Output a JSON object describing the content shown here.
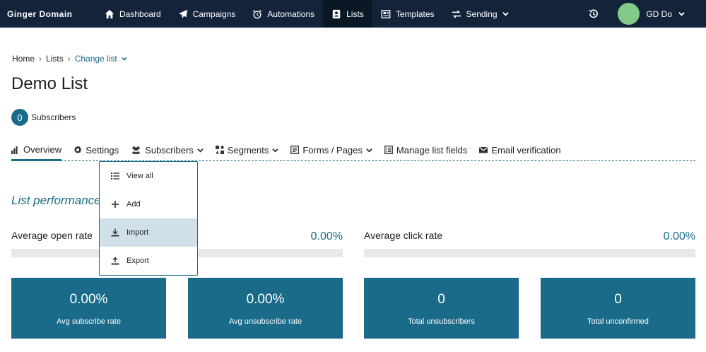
{
  "nav": {
    "brand": "Ginger Domain",
    "items": [
      {
        "label": "Dashboard",
        "icon": "home-icon"
      },
      {
        "label": "Campaigns",
        "icon": "paper-plane-icon"
      },
      {
        "label": "Automations",
        "icon": "alarm-clock-icon"
      },
      {
        "label": "Lists",
        "icon": "address-book-icon"
      },
      {
        "label": "Templates",
        "icon": "newspaper-icon"
      },
      {
        "label": "Sending",
        "icon": "exchange-arrows-icon"
      }
    ],
    "active": "Lists",
    "user": {
      "name": "GD Do",
      "avatar_color": "#82c98a"
    }
  },
  "breadcrumb": {
    "home": "Home",
    "lists": "Lists",
    "change": "Change list"
  },
  "page": {
    "title": "Demo List",
    "subscribers_count": "0",
    "subscribers_label": "Subscribers"
  },
  "tabs": [
    {
      "label": "Overview",
      "icon": "bar-chart-icon"
    },
    {
      "label": "Settings",
      "icon": "gear-icon"
    },
    {
      "label": "Subscribers",
      "icon": "users-icon"
    },
    {
      "label": "Segments",
      "icon": "segments-icon"
    },
    {
      "label": "Forms / Pages",
      "icon": "form-icon"
    },
    {
      "label": "Manage list fields",
      "icon": "list-fields-icon"
    },
    {
      "label": "Email verification",
      "icon": "envelope-icon"
    }
  ],
  "dropdown": {
    "items": [
      {
        "label": "View all",
        "icon": "list-icon"
      },
      {
        "label": "Add",
        "icon": "plus-icon"
      },
      {
        "label": "Import",
        "icon": "download-icon"
      },
      {
        "label": "Export",
        "icon": "upload-icon"
      }
    ],
    "highlighted": "Import"
  },
  "performance": {
    "title": "List performance",
    "open_rate_label": "Average open rate",
    "open_rate_value": "0.00%",
    "click_rate_label": "Average click rate",
    "click_rate_value": "0.00%",
    "stats": [
      {
        "value": "0.00%",
        "label": "Avg subscribe rate"
      },
      {
        "value": "0.00%",
        "label": "Avg unsubscribe rate"
      },
      {
        "value": "0",
        "label": "Total unsubscribers"
      },
      {
        "value": "0",
        "label": "Total unconfirmed"
      }
    ]
  },
  "colors": {
    "nav_bg": "#13243a",
    "accent": "#1a6b8a",
    "dropdown_highlight": "#cfe0e9"
  }
}
